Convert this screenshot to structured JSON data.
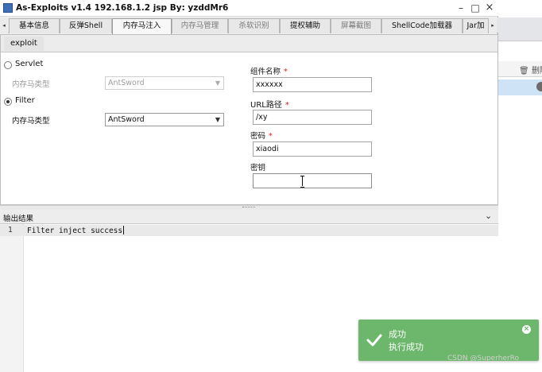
{
  "window": {
    "title": "As-Exploits v1.4 192.168.1.2 jsp By: yzddMr6",
    "controls": {
      "minimize": "–",
      "maximize": "□",
      "close": "×"
    }
  },
  "tabs": {
    "scroll_left": "◂",
    "scroll_right": "▸",
    "items": [
      {
        "label": "基本信息",
        "enabled": true
      },
      {
        "label": "反弹Shell",
        "enabled": true
      },
      {
        "label": "内存马注入",
        "active": true
      },
      {
        "label": "内存马管理",
        "enabled": false
      },
      {
        "label": "杀软识别",
        "enabled": false
      },
      {
        "label": "提权辅助",
        "enabled": true
      },
      {
        "label": "屏幕截图",
        "enabled": false
      },
      {
        "label": "ShellCode加载器",
        "enabled": true
      },
      {
        "label": "Jar加",
        "enabled": true
      }
    ]
  },
  "form": {
    "section_title": "exploit",
    "servlet": {
      "radio_label": "Servlet",
      "checked": false,
      "type_label": "内存马类型",
      "type_value": "AntSword"
    },
    "filter": {
      "radio_label": "Filter",
      "checked": true,
      "type_label": "内存马类型",
      "type_value": "AntSword"
    },
    "fields": {
      "component_label": "组件名称",
      "component_value": "xxxxxx",
      "url_label": "URL路径",
      "url_value": "/xy",
      "password_label": "密码",
      "password_value": "xiaodi",
      "key_label": "密钥",
      "key_value": "",
      "required_mark": "*"
    },
    "select_arrow": "▼"
  },
  "output": {
    "title": "输出结果",
    "collapse": "⌄",
    "lines": [
      {
        "number": "1",
        "text": "Filter inject success"
      }
    ]
  },
  "toast": {
    "title": "成功",
    "message": "执行成功",
    "close": "×",
    "color": "#6cb76c"
  },
  "background_app": {
    "delete_label": "删除"
  },
  "watermark": "CSDN @SuperherRo"
}
